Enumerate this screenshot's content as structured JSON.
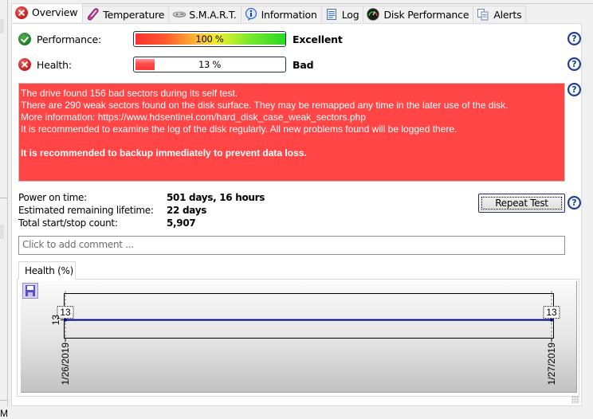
{
  "tabs": [
    {
      "label": "Overview",
      "icon": "error-icon",
      "active": true
    },
    {
      "label": "Temperature",
      "icon": "thermometer-icon",
      "active": false
    },
    {
      "label": "S.M.A.R.T.",
      "icon": "smart-disk-icon",
      "active": false
    },
    {
      "label": "Information",
      "icon": "info-icon",
      "active": false
    },
    {
      "label": "Log",
      "icon": "log-document-icon",
      "active": false
    },
    {
      "label": "Disk Performance",
      "icon": "speedometer-icon",
      "active": false
    },
    {
      "label": "Alerts",
      "icon": "alerts-icon",
      "active": false
    }
  ],
  "overview": {
    "performance": {
      "label": "Performance:",
      "value_text": "100 %",
      "value": 100,
      "status": "Excellent",
      "icon": "ok-check-icon"
    },
    "health": {
      "label": "Health:",
      "value_text": "13 %",
      "value": 13,
      "status": "Bad",
      "icon": "error-icon"
    },
    "alert": {
      "lines": [
        "The drive found 156 bad sectors during its self test.",
        "There are 290 weak sectors found on the disk surface. They may be remapped any time in the later use of the disk.",
        "More information: https://www.hdsentinel.com/hard_disk_case_weak_sectors.php",
        "It is recommended to examine the log of the disk regularly. All new problems found will be logged there."
      ],
      "bold_line": "It is recommended to backup immediately to prevent data loss.",
      "background_color": "#ff4545"
    },
    "info": [
      {
        "label": "Power on time:",
        "value": "501 days, 16 hours"
      },
      {
        "label": "Estimated remaining lifetime:",
        "value": "22 days"
      },
      {
        "label": "Total start/stop count:",
        "value": "5,907"
      }
    ],
    "repeat_test_label": "Repeat Test",
    "comment_placeholder": "Click to add comment ...",
    "help_glyph": "?"
  },
  "graph": {
    "tab_label": "Health (%)",
    "save_icon": "save-floppy-icon"
  },
  "chart_data": {
    "type": "line",
    "title": "Health (%)",
    "x": [
      "1/26/2019",
      "1/27/2019"
    ],
    "series": [
      {
        "name": "Health (%)",
        "values": [
          13,
          13
        ],
        "color": "#00008b"
      }
    ],
    "data_labels": [
      "13",
      "13"
    ],
    "y_tick_labels": [
      "13"
    ],
    "x_tick_labels": [
      "1/26/2019",
      "1/27/2019"
    ],
    "xlabel": "",
    "ylabel": "",
    "grid": false
  },
  "status_bar": {
    "left_text": "M"
  }
}
